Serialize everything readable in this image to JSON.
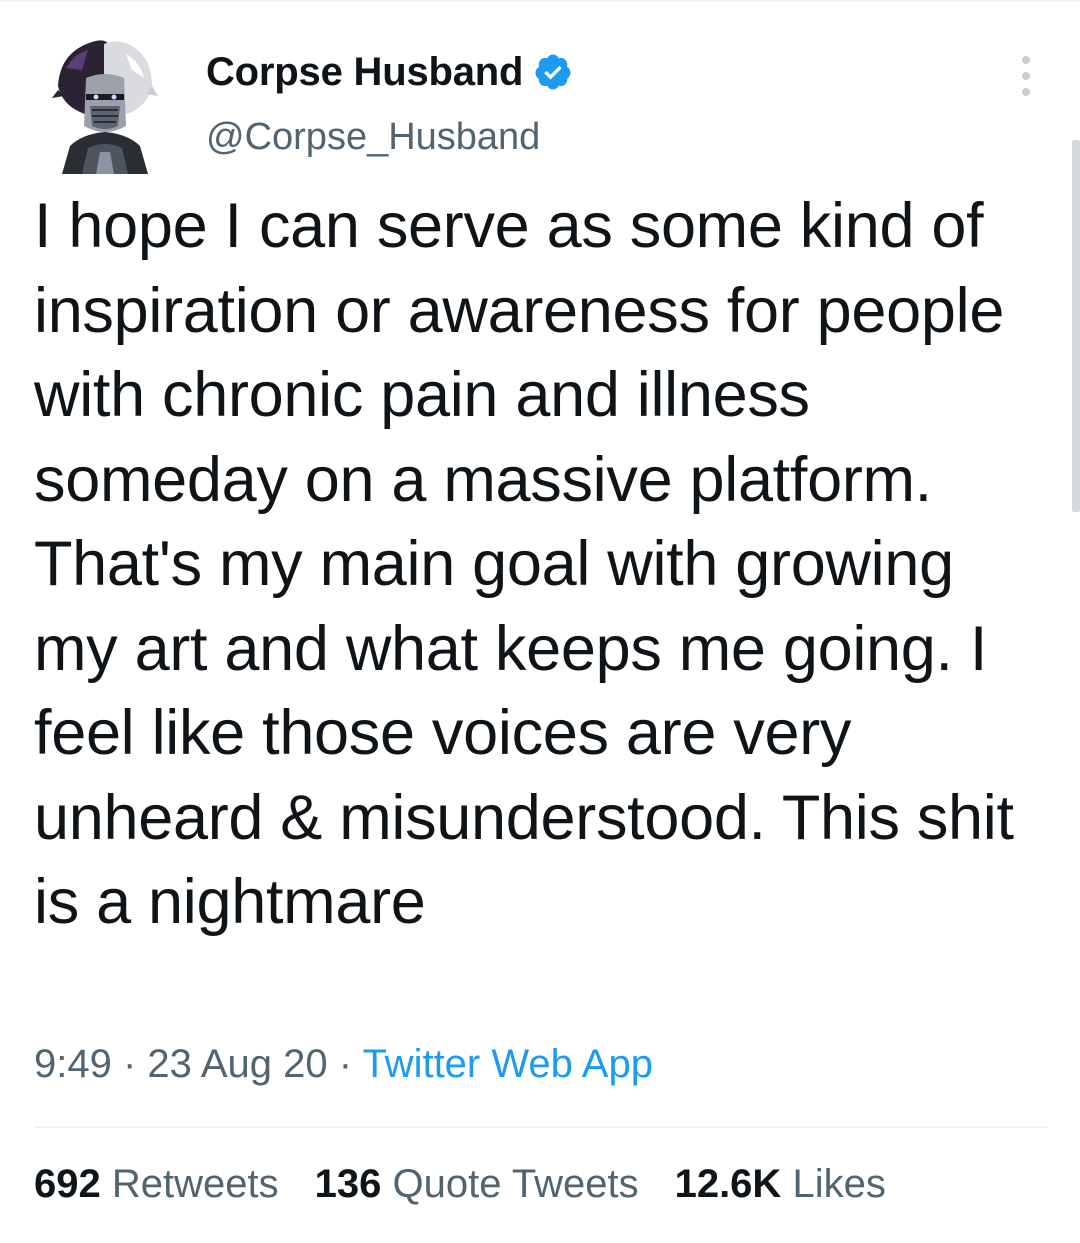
{
  "tweet": {
    "author": {
      "display_name": "Corpse Husband",
      "handle": "@Corpse_Husband",
      "verified_icon": "verified-badge-icon",
      "avatar_icon": "avatar-image"
    },
    "text": "I hope I can serve as some kind of inspiration or awareness for people with chronic pain and illness someday on a massive platform. That's my main goal with growing my art and what keeps me going. I feel like those voices are very unheard & misunderstood. This shit is a nightmare",
    "time": "9:49",
    "separator": "·",
    "date": "23 Aug 20",
    "source": "Twitter Web App",
    "stats": {
      "retweets_count": "692",
      "retweets_label": "Retweets",
      "quote_tweets_count": "136",
      "quote_tweets_label": "Quote Tweets",
      "likes_count": "12.6K",
      "likes_label": "Likes"
    }
  },
  "colors": {
    "text_primary": "#0f1419",
    "text_secondary": "#536471",
    "accent": "#1d9bf0",
    "divider": "#eff3f4"
  },
  "icons": {
    "more": "more-options-icon"
  }
}
